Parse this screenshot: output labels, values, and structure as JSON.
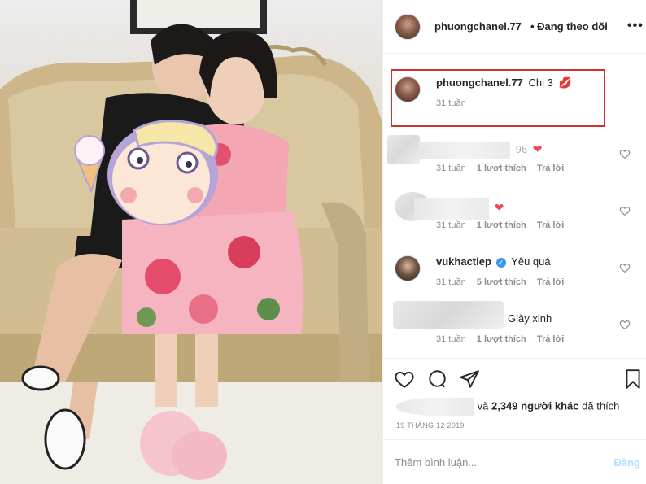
{
  "header": {
    "username": "phuongchanel.77",
    "follow_status": "• Đang theo dõi",
    "more_icon": "more-horizontal-icon"
  },
  "comments": [
    {
      "user": "phuongchanel.77",
      "text": "Chị 3",
      "emoji": "💋",
      "time": "31 tuần",
      "likes": "",
      "reply": "",
      "highlighted": true
    },
    {
      "user": "",
      "text": "96",
      "emoji": "❤",
      "time": "31 tuần",
      "likes": "1 lượt thích",
      "reply": "Trả lời"
    },
    {
      "user": "",
      "text": "",
      "emoji": "❤",
      "time": "31 tuần",
      "likes": "1 lượt thích",
      "reply": "Trả lời"
    },
    {
      "user": "vukhactiep",
      "text": "Yêu quá",
      "emoji": "",
      "time": "31 tuần",
      "likes": "5 lượt thích",
      "reply": "Trả lời",
      "verified": true
    },
    {
      "user": "",
      "text": "Giày xinh",
      "emoji": "",
      "time": "31 tuần",
      "likes": "1 lượt thích",
      "reply": "Trả lời"
    }
  ],
  "actions": {
    "like_icon": "heart-icon",
    "comment_icon": "comment-icon",
    "share_icon": "share-icon",
    "save_icon": "bookmark-icon"
  },
  "likes": {
    "connector": "và",
    "count": "2,349 người khác",
    "suffix": "đã thích"
  },
  "date": "19 THÁNG 12 2019",
  "add_comment": {
    "placeholder": "Thêm bình luận...",
    "post_label": "Đăng"
  },
  "colors": {
    "highlight_border": "#d0302f",
    "heart_red": "#ed4956",
    "post_disabled": "#b2dffc",
    "verified_blue": "#3897f0"
  }
}
